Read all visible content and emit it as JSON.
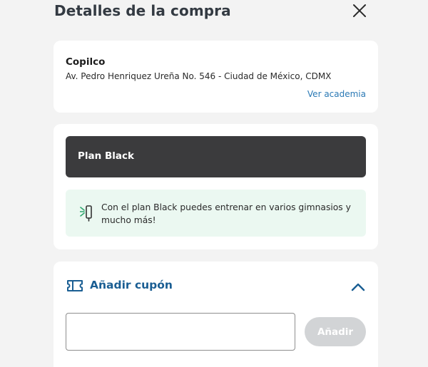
{
  "header": {
    "title": "Detalles de la compra"
  },
  "gym": {
    "name": "Copilco",
    "address": "Av. Pedro Henriquez Ureña No. 546 - Ciudad de México, CDMX",
    "link_label": "Ver academia"
  },
  "plan": {
    "name": "Plan Black",
    "info": "Con el plan Black puedes entrenar en varios gimnasios y mucho más!",
    "info_icon": "turnstile-access-icon",
    "info_accent": "#2fa66f"
  },
  "coupon": {
    "label": "Añadir cupón",
    "input_value": "",
    "input_placeholder": "",
    "apply_label": "Añadir",
    "accent": "#1a5e93"
  }
}
